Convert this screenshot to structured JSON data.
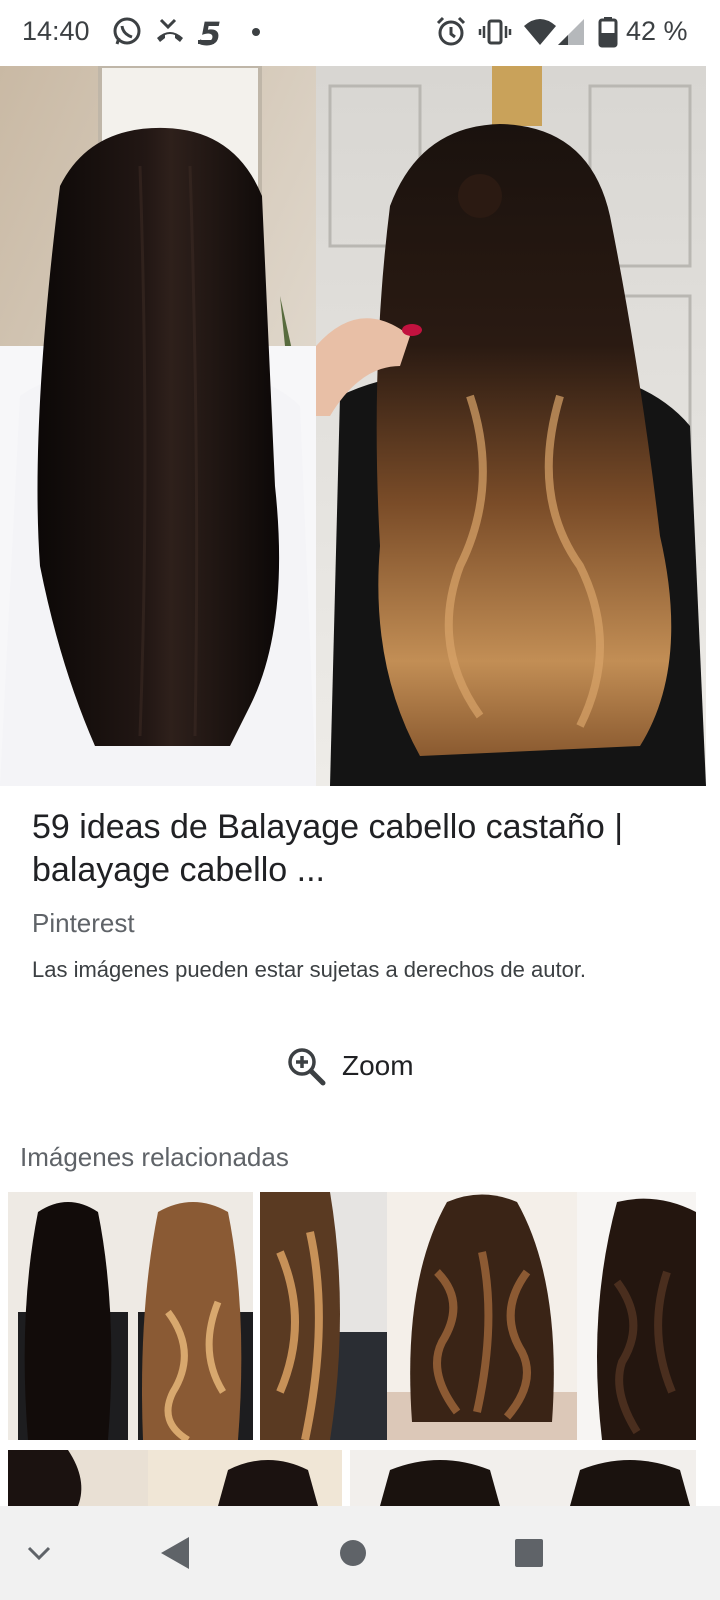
{
  "status_bar": {
    "time": "14:40",
    "notification_icons": [
      "whatsapp-icon",
      "missed-call-icon",
      "channel-5-icon",
      "dot-icon"
    ],
    "system_icons": [
      "alarm-icon",
      "vibrate-icon",
      "wifi-icon",
      "signal-icon",
      "battery-icon"
    ],
    "battery": "42 %"
  },
  "result": {
    "title": "59 ideas de Balayage cabello castaño | balayage cabello ...",
    "source": "Pinterest",
    "copyright_note": "Las imágenes pueden estar sujetas a derechos de autor.",
    "zoom_label": "Zoom"
  },
  "related": {
    "heading": "Imágenes relacionadas"
  },
  "nav_bar": {
    "buttons": [
      "chevron-down-icon",
      "back-icon",
      "home-icon",
      "recents-icon"
    ]
  },
  "colors": {
    "dark_hair": "#140e0c",
    "caramel": "#b07a45",
    "text_secondary": "#5f6368",
    "nav_background": "#f1f1f1"
  }
}
